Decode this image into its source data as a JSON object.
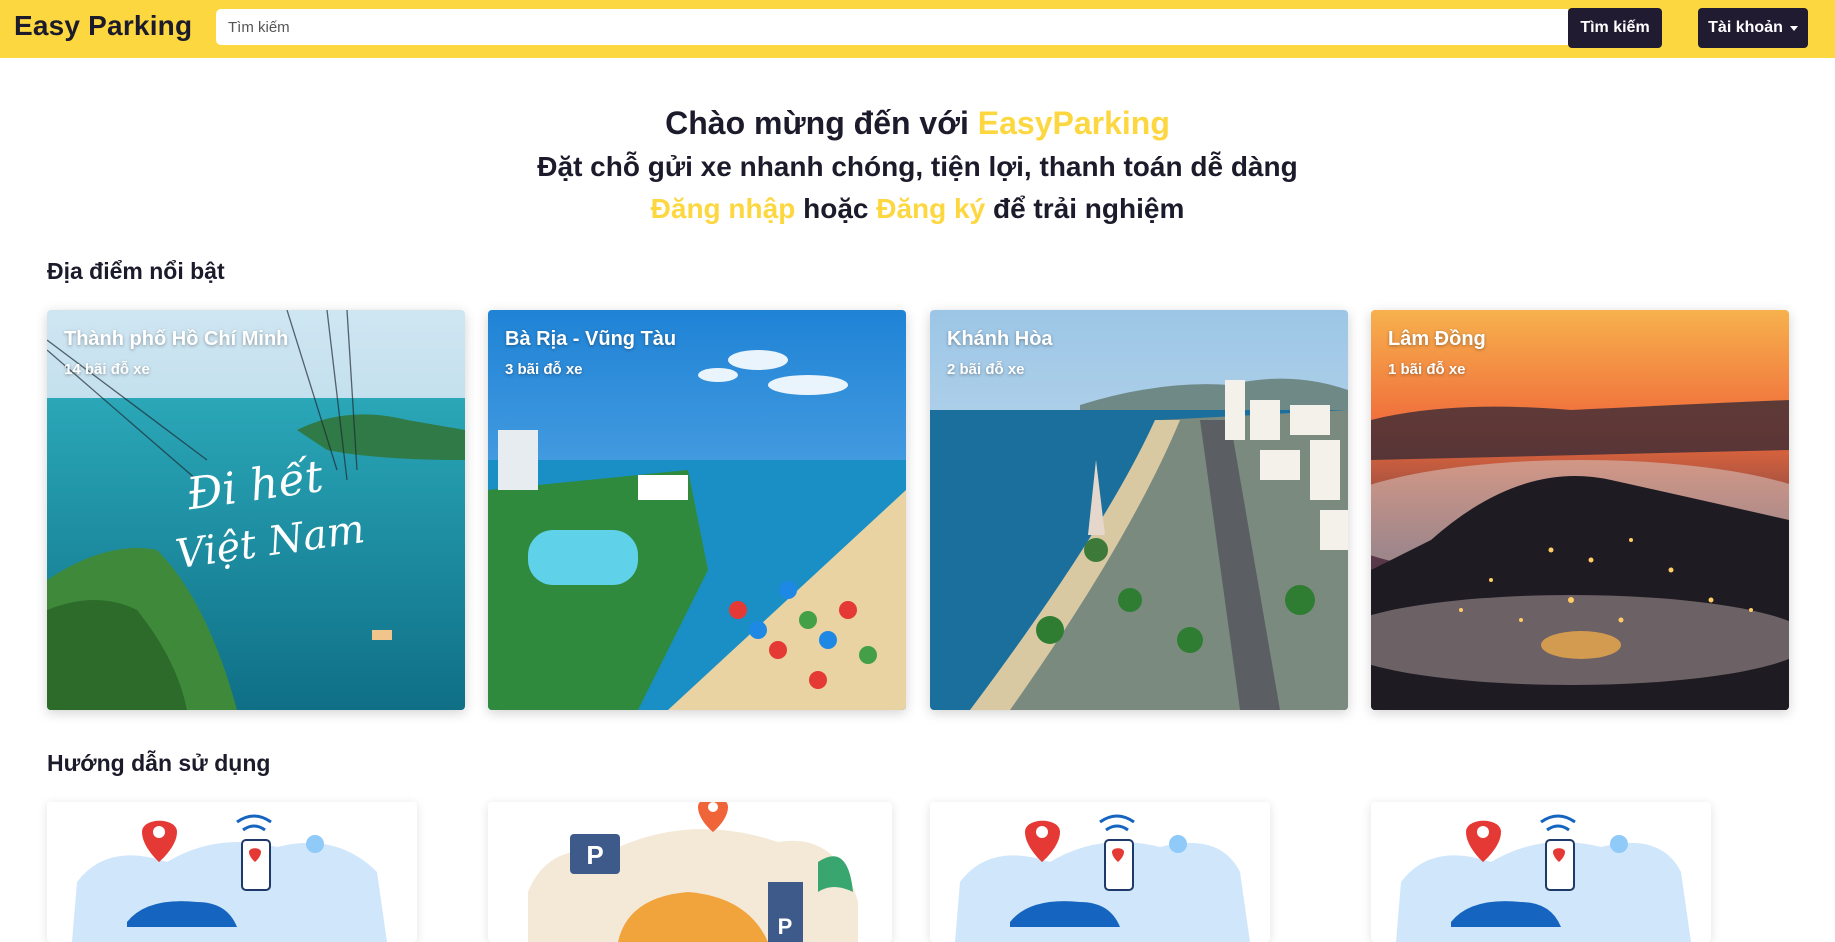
{
  "navbar": {
    "brand": "Easy Parking",
    "search_placeholder": "Tìm kiếm",
    "search_button": "Tìm kiếm",
    "account_button": "Tài khoản"
  },
  "hero": {
    "welcome": "Chào mừng đến với",
    "brand_name": "EasyParking",
    "tagline": "Đặt chỗ gửi xe nhanh chóng, tiện lợi, thanh toán dễ dàng",
    "login_link": "Đăng nhập",
    "or_text": "hoặc",
    "register_link": "Đăng ký",
    "suffix": "để trải nghiệm"
  },
  "featured": {
    "title": "Địa điểm nổi bật",
    "locations": [
      {
        "name": "Thành phố Hồ Chí Minh",
        "count": "14 bãi đỗ xe"
      },
      {
        "name": "Bà Rịa - Vũng Tàu",
        "count": "3 bãi đỗ xe"
      },
      {
        "name": "Khánh Hòa",
        "count": "2 bãi đỗ xe"
      },
      {
        "name": "Lâm Đồng",
        "count": "1 bãi đỗ xe"
      }
    ]
  },
  "guide": {
    "title": "Hướng dẫn sử dụng"
  },
  "colors": {
    "brand_yellow": "#fdd740",
    "dark_navy": "#211b32",
    "text": "#1c1b2b"
  }
}
